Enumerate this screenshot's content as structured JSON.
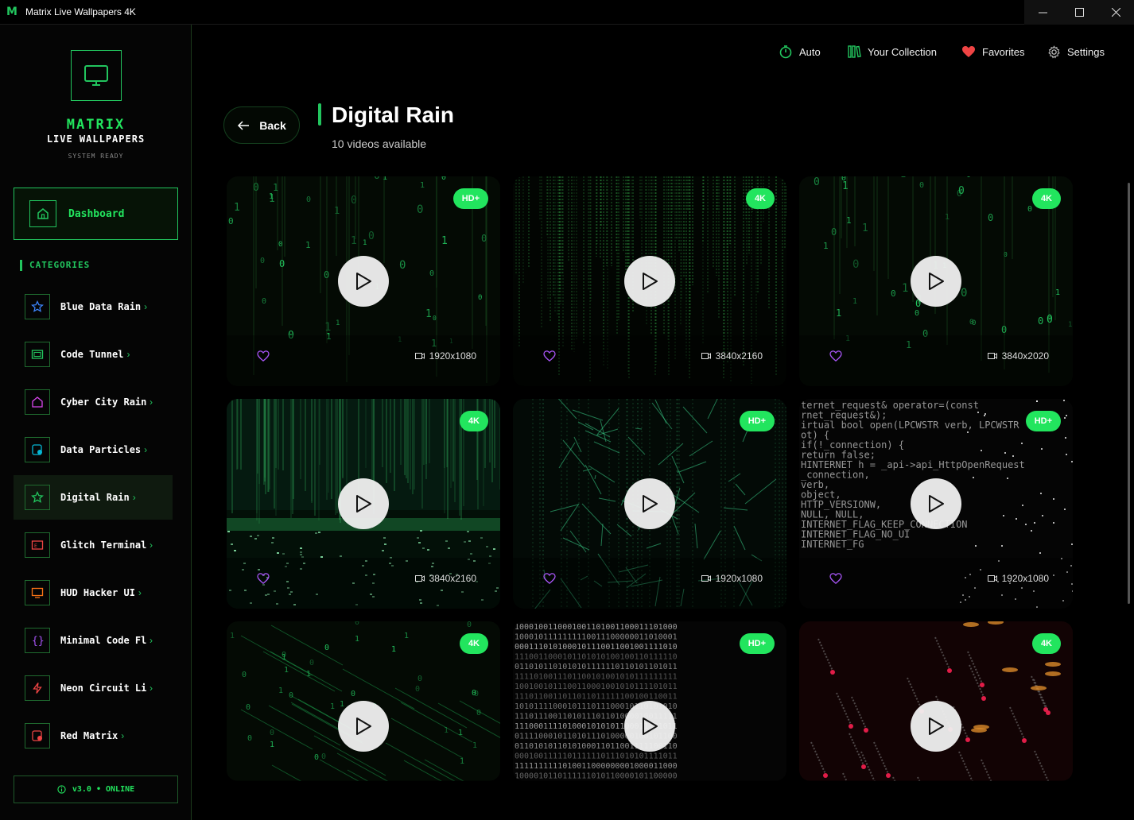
{
  "window": {
    "title": "Matrix Live Wallpapers 4K",
    "app_icon": "M"
  },
  "sidebar": {
    "brand_title": "MATRIX",
    "brand_subtitle": "LIVE WALLPAPERS",
    "brand_status": "SYSTEM READY",
    "dashboard_label": "Dashboard",
    "categories_heading": "CATEGORIES",
    "categories": [
      {
        "label": "Blue Data Rain",
        "icon": "star-icon",
        "color": "#3b82f6"
      },
      {
        "label": "Code Tunnel",
        "icon": "terminal-icon",
        "color": "#22c55e"
      },
      {
        "label": "Cyber City Rain",
        "icon": "home-icon",
        "color": "#d946ef"
      },
      {
        "label": "Data Particles",
        "icon": "shield-icon",
        "color": "#06b6d4"
      },
      {
        "label": "Digital Rain",
        "icon": "star-icon",
        "color": "#22c55e"
      },
      {
        "label": "Glitch Terminal",
        "icon": "tv-icon",
        "color": "#ef4444"
      },
      {
        "label": "HUD Hacker UI",
        "icon": "monitor-icon",
        "color": "#f97316"
      },
      {
        "label": "Minimal Code Flow",
        "icon": "braces-icon",
        "color": "#a855f7"
      },
      {
        "label": "Neon Circuit Lines",
        "icon": "bolt-icon",
        "color": "#ef4444"
      },
      {
        "label": "Red Matrix",
        "icon": "shield-icon",
        "color": "#ef4444"
      }
    ],
    "version_label": "v3.0 • ONLINE"
  },
  "topnav": {
    "auto": "Auto",
    "collection": "Your Collection",
    "favorites": "Favorites",
    "settings": "Settings"
  },
  "header": {
    "back_label": "Back",
    "title": "Digital Rain",
    "subtitle": "10 videos available"
  },
  "videos": [
    {
      "badge": "HD+",
      "resolution": "1920x1080",
      "style": "sparse-green"
    },
    {
      "badge": "4K",
      "resolution": "3840x2160",
      "style": "dense-lines"
    },
    {
      "badge": "4K",
      "resolution": "3840x2020",
      "style": "sparse-green"
    },
    {
      "badge": "4K",
      "resolution": "3840x2160",
      "style": "horizon"
    },
    {
      "badge": "HD+",
      "resolution": "1920x1080",
      "style": "network"
    },
    {
      "badge": "HD+",
      "resolution": "1920x1080",
      "style": "code"
    },
    {
      "badge": "4K",
      "resolution": "",
      "style": "diagonal"
    },
    {
      "badge": "HD+",
      "resolution": "",
      "style": "binary-white"
    },
    {
      "badge": "4K",
      "resolution": "",
      "style": "red"
    }
  ],
  "colors": {
    "accent": "#22c55e",
    "badge": "#22e55e",
    "heart": "#a855f7",
    "fav_heart": "#ef4444"
  }
}
